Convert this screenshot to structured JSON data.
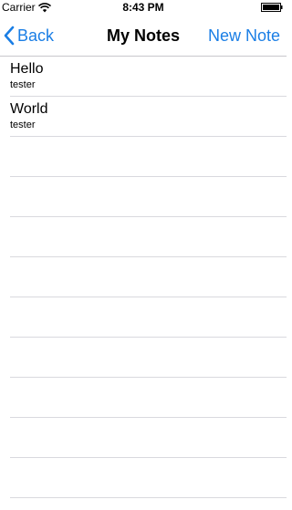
{
  "status_bar": {
    "carrier": "Carrier",
    "time": "8:43 PM"
  },
  "nav_bar": {
    "back_label": "Back",
    "title": "My Notes",
    "new_note_label": "New Note"
  },
  "notes": [
    {
      "title": "Hello",
      "author": "tester"
    },
    {
      "title": "World",
      "author": "tester"
    }
  ],
  "colors": {
    "accent": "#1a7ee5",
    "separator": "#d9d9de"
  }
}
